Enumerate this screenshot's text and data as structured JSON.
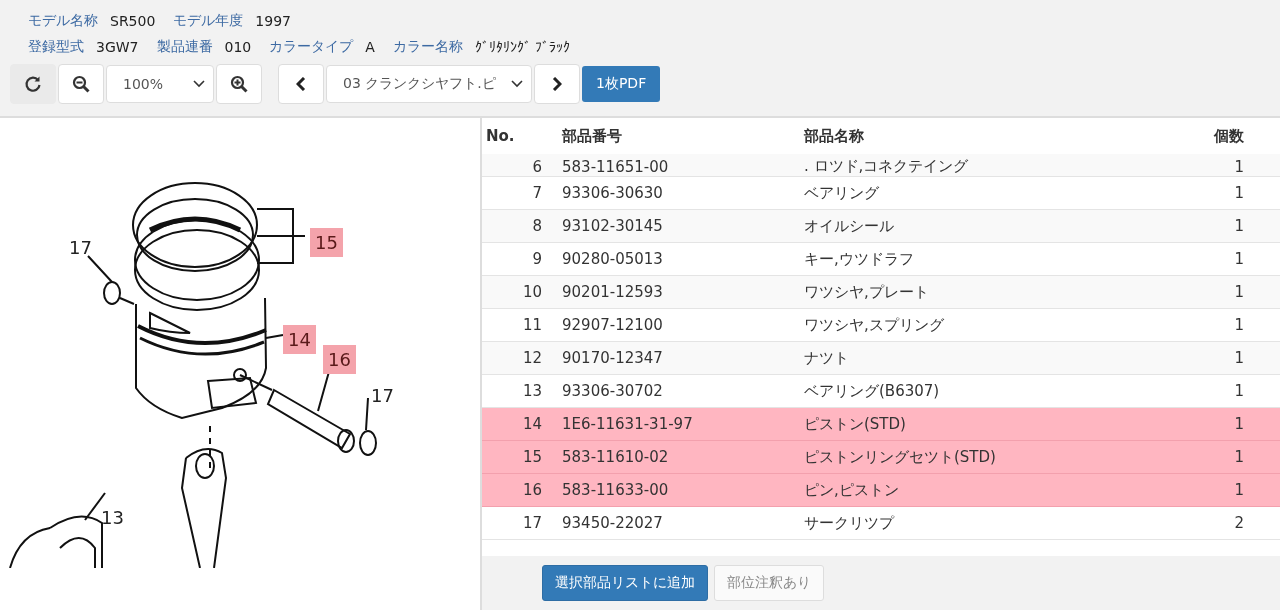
{
  "model_info": [
    {
      "label": "モデル名称",
      "value": "SR500"
    },
    {
      "label": "モデル年度",
      "value": "1997"
    }
  ],
  "model_info_2": [
    {
      "label": "登録型式",
      "value": "3GW7"
    },
    {
      "label": "製品連番",
      "value": "010"
    },
    {
      "label": "カラータイプ",
      "value": "A"
    },
    {
      "label": "カラー名称",
      "value": "ｸﾞﾘﾀﾘﾝｸﾞ ﾌﾞﾗｯｸ"
    }
  ],
  "toolbar": {
    "zoom": "100%",
    "page": "03 クランクシヤフト.ピ",
    "pdf_button": "1枚PDF"
  },
  "callouts": [
    {
      "label": "17",
      "selected": false
    },
    {
      "label": "15",
      "selected": true
    },
    {
      "label": "14",
      "selected": true
    },
    {
      "label": "16",
      "selected": true
    },
    {
      "label": "17",
      "selected": false
    },
    {
      "label": "13",
      "selected": false
    }
  ],
  "table": {
    "columns": [
      "No.",
      "部品番号",
      "部品名称",
      "個数"
    ],
    "rows": [
      {
        "no": "6",
        "part_number": "583-11651-00",
        "name": ". ロツド,コネクテイング",
        "qty": "1",
        "selected": false
      },
      {
        "no": "7",
        "part_number": "93306-30630",
        "name": "ベアリング",
        "qty": "1",
        "selected": false
      },
      {
        "no": "8",
        "part_number": "93102-30145",
        "name": "オイルシール",
        "qty": "1",
        "selected": false
      },
      {
        "no": "9",
        "part_number": "90280-05013",
        "name": "キー,ウツドラフ",
        "qty": "1",
        "selected": false
      },
      {
        "no": "10",
        "part_number": "90201-12593",
        "name": "ワツシヤ,プレート",
        "qty": "1",
        "selected": false
      },
      {
        "no": "11",
        "part_number": "92907-12100",
        "name": "ワツシヤ,スプリング",
        "qty": "1",
        "selected": false
      },
      {
        "no": "12",
        "part_number": "90170-12347",
        "name": "ナツト",
        "qty": "1",
        "selected": false
      },
      {
        "no": "13",
        "part_number": "93306-30702",
        "name": "ベアリング(B6307)",
        "qty": "1",
        "selected": false
      },
      {
        "no": "14",
        "part_number": "1E6-11631-31-97",
        "name": "ピストン(STD)",
        "qty": "1",
        "selected": true
      },
      {
        "no": "15",
        "part_number": "583-11610-02",
        "name": "ピストンリングセツト(STD)",
        "qty": "1",
        "selected": true
      },
      {
        "no": "16",
        "part_number": "583-11633-00",
        "name": "ピン,ピストン",
        "qty": "1",
        "selected": true
      },
      {
        "no": "17",
        "part_number": "93450-22027",
        "name": "サークリツプ",
        "qty": "2",
        "selected": false
      }
    ]
  },
  "buttons": [
    {
      "label": "選択部品リストに追加",
      "disabled": false
    },
    {
      "label": "部位注釈あり",
      "disabled": true
    }
  ]
}
